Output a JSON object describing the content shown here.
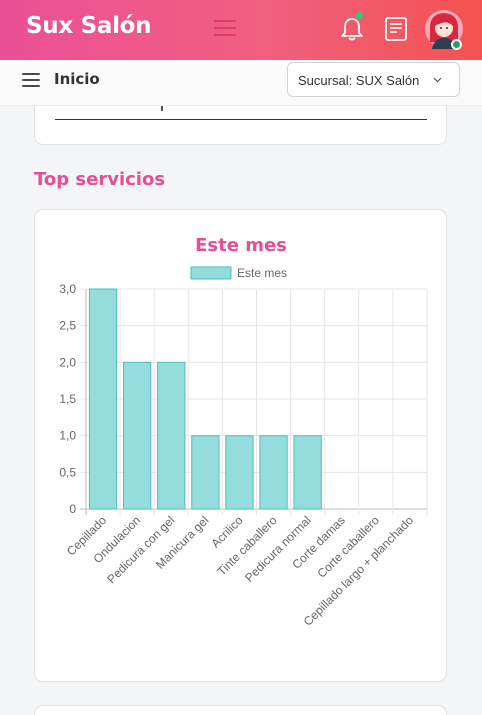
{
  "header": {
    "brand": "Sux Salón",
    "icons": [
      "menu-icon",
      "bell-icon",
      "notes-icon",
      "avatar"
    ],
    "colors": {
      "gradient_start": "#ec4f95",
      "gradient_end": "#f4524f",
      "online": "#21a366"
    }
  },
  "subheader": {
    "breadcrumb": "Inicio",
    "branch_select": "Sucursal: SUX Salón"
  },
  "section": {
    "title": "Top servicios"
  },
  "chart_data": {
    "type": "bar",
    "title": "Este mes",
    "legend": [
      "Este mes"
    ],
    "legend_position": "top",
    "categories": [
      "Cepillado",
      "Ondulacion",
      "Pedicura con gel",
      "Manicura gel",
      "Acrilico",
      "Tinte caballero",
      "Pedicura normal",
      "Corte damas",
      "Corte caballero",
      "Cepillado largo + planchado"
    ],
    "series": [
      {
        "name": "Este mes",
        "values": [
          3,
          2,
          2,
          1,
          1,
          1,
          1,
          0,
          0,
          0
        ]
      }
    ],
    "yticks": [
      "0",
      "0,5",
      "1,0",
      "1,5",
      "2,0",
      "2,5",
      "3,0"
    ],
    "ylim": [
      0,
      3
    ],
    "grid": true,
    "colors": {
      "bar_fill": "#95dcdc",
      "bar_stroke": "#4bc0c0",
      "title": "#e84d95"
    }
  }
}
